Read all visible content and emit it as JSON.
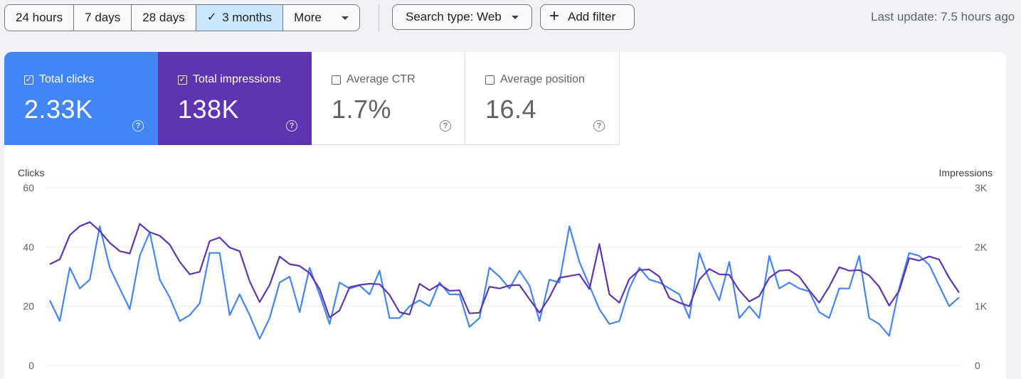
{
  "toolbar": {
    "ranges": [
      {
        "label": "24 hours",
        "active": false
      },
      {
        "label": "7 days",
        "active": false
      },
      {
        "label": "28 days",
        "active": false
      },
      {
        "label": "3 months",
        "active": true
      },
      {
        "label": "More",
        "active": false
      }
    ],
    "search_type_label": "Search type: Web",
    "add_filter_label": "Add filter",
    "last_update": "Last update: 7.5 hours ago"
  },
  "metrics": [
    {
      "label": "Total clicks",
      "value": "2.33K",
      "checked": true,
      "color": "#4285f4"
    },
    {
      "label": "Total impressions",
      "value": "138K",
      "checked": true,
      "color": "#5e35b1"
    },
    {
      "label": "Average CTR",
      "value": "1.7%",
      "checked": false,
      "color": "#ffffff"
    },
    {
      "label": "Average position",
      "value": "16.4",
      "checked": false,
      "color": "#ffffff"
    }
  ],
  "chart_data": {
    "type": "line",
    "left_axis": {
      "label": "Clicks",
      "ticks": [
        "60",
        "40",
        "20",
        "0"
      ],
      "ylim": [
        0,
        60
      ]
    },
    "right_axis": {
      "label": "Impressions",
      "ticks": [
        "3K",
        "2K",
        "1K",
        "0"
      ],
      "ylim": [
        0,
        3000
      ]
    },
    "grid": true,
    "series": [
      {
        "color": "#4285f4",
        "axis": "left",
        "values": [
          22,
          15,
          33,
          26,
          29,
          47,
          33,
          26,
          19,
          37,
          45,
          29,
          23,
          15,
          17,
          21,
          38,
          38,
          17,
          24,
          17,
          9,
          16,
          28,
          30,
          18,
          33,
          24,
          14,
          28,
          26,
          27,
          24,
          32,
          16,
          16,
          20,
          22,
          20,
          28,
          24,
          24,
          13,
          16,
          33,
          30,
          26,
          32,
          27,
          15,
          29,
          28,
          47,
          35,
          27,
          19,
          14,
          15,
          26,
          33,
          29,
          28,
          26,
          24,
          16,
          38,
          29,
          22,
          35,
          16,
          20,
          16,
          37,
          26,
          28,
          26,
          25,
          18,
          16,
          26,
          26,
          37,
          16,
          14,
          10,
          26,
          38,
          37,
          34,
          27,
          20,
          23
        ]
      },
      {
        "color": "#5e35b1",
        "axis": "right",
        "values": [
          1710,
          1790,
          2200,
          2350,
          2420,
          2270,
          2070,
          1930,
          1890,
          2390,
          2250,
          2190,
          2040,
          1750,
          1540,
          1580,
          2100,
          2160,
          1990,
          1930,
          1420,
          1070,
          1360,
          1840,
          1710,
          1680,
          1560,
          1290,
          810,
          930,
          1320,
          1360,
          1380,
          1370,
          1190,
          900,
          860,
          1380,
          1270,
          1370,
          1260,
          1270,
          880,
          890,
          1330,
          1300,
          1350,
          1360,
          1120,
          890,
          1150,
          1480,
          1510,
          1540,
          1290,
          2050,
          1200,
          1060,
          1460,
          1610,
          1620,
          1500,
          1140,
          1060,
          1000,
          1450,
          1630,
          1540,
          1530,
          1270,
          1080,
          1170,
          1480,
          1600,
          1610,
          1500,
          1270,
          1060,
          1330,
          1660,
          1600,
          1610,
          1520,
          1330,
          1010,
          1260,
          1810,
          1770,
          1840,
          1790,
          1480,
          1230
        ]
      }
    ]
  }
}
